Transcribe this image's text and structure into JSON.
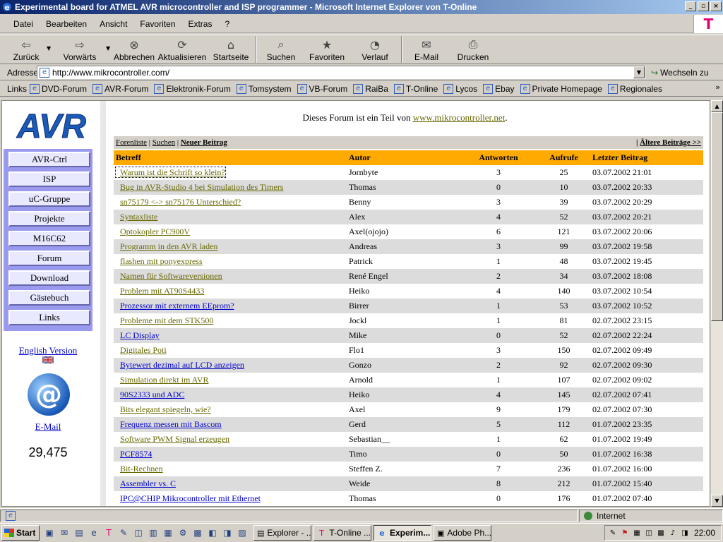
{
  "window": {
    "title": "Experimental board for ATMEL AVR microcontroller and ISP programmer - Microsoft Internet Explorer von T-Online",
    "btn_min": "_",
    "btn_max": "▫",
    "btn_close": "×"
  },
  "menu": [
    "Datei",
    "Bearbeiten",
    "Ansicht",
    "Favoriten",
    "Extras",
    "?"
  ],
  "isp_logo": "T",
  "toolbar": {
    "back": "Zurück",
    "forward": "Vorwärts",
    "stop": "Abbrechen",
    "refresh": "Aktualisieren",
    "home": "Startseite",
    "search": "Suchen",
    "favorites": "Favoriten",
    "history": "Verlauf",
    "mail": "E-Mail",
    "print": "Drucken"
  },
  "address": {
    "label": "Adresse",
    "url": "http://www.mikrocontroller.com/",
    "go": "Wechseln zu"
  },
  "links": {
    "label": "Links",
    "items": [
      "DVD-Forum",
      "AVR-Forum",
      "Elektronik-Forum",
      "Tomsystem",
      "VB-Forum",
      "RaiBa",
      "T-Online",
      "Lycos",
      "Ebay",
      "Private Homepage",
      "Regionales"
    ]
  },
  "sidebar": {
    "logo_text": "AVR",
    "nav": [
      "AVR-Ctrl",
      "ISP",
      "uC-Gruppe",
      "Projekte",
      "M16C62",
      "Forum",
      "Download",
      "Gästebuch",
      "Links"
    ],
    "english": "English Version",
    "email": "E-Mail",
    "counter": "29,475"
  },
  "forum": {
    "notice_prefix": "Dieses Forum ist ein Teil von ",
    "notice_link": "www.mikrocontroller.net",
    "notice_suffix": ".",
    "nav_list": "Forenliste",
    "nav_search": "Suchen",
    "nav_new": "Neuer Beitrag",
    "sep": "|",
    "nav_older": "Ältere Beiträge >>",
    "headers": {
      "subject": "Betreff",
      "author": "Autor",
      "replies": "Antworten",
      "views": "Aufrufe",
      "last": "Letzter Beitrag"
    },
    "rows": [
      {
        "subject": "Warum ist die Schrift so klein?",
        "author": "Jornbyte",
        "replies": "3",
        "views": "25",
        "last": "03.07.2002 21:01",
        "state": "focused"
      },
      {
        "subject": "Bug in AVR-Studio 4 bei Simulation des Timers",
        "author": "Thomas",
        "replies": "0",
        "views": "10",
        "last": "03.07.2002 20:33",
        "state": "visited"
      },
      {
        "subject": "sn75179 <-> sn75176 Unterschied?",
        "author": "Benny",
        "replies": "3",
        "views": "39",
        "last": "03.07.2002 20:29",
        "state": "visited"
      },
      {
        "subject": "Syntaxliste",
        "author": "Alex",
        "replies": "4",
        "views": "52",
        "last": "03.07.2002 20:21",
        "state": "visited"
      },
      {
        "subject": "Optokopler PC900V",
        "author": "Axel(ojojo)",
        "replies": "6",
        "views": "121",
        "last": "03.07.2002 20:06",
        "state": "visited"
      },
      {
        "subject": "Programm in den AVR laden",
        "author": "Andreas",
        "replies": "3",
        "views": "99",
        "last": "03.07.2002 19:58",
        "state": "visited"
      },
      {
        "subject": "flashen mit ponyexpress",
        "author": "Patrick",
        "replies": "1",
        "views": "48",
        "last": "03.07.2002 19:45",
        "state": "visited"
      },
      {
        "subject": "Namen für Softwareversionen",
        "author": "René Engel",
        "replies": "2",
        "views": "34",
        "last": "03.07.2002 18:08",
        "state": "visited"
      },
      {
        "subject": "Problem mit AT90S4433",
        "author": "Heiko",
        "replies": "4",
        "views": "140",
        "last": "03.07.2002 10:54",
        "state": "visited"
      },
      {
        "subject": "Prozessor mit externem EEprom?",
        "author": "Birrer",
        "replies": "1",
        "views": "53",
        "last": "03.07.2002 10:52",
        "state": "fresh"
      },
      {
        "subject": "Probleme mit dem STK500",
        "author": "Jockl",
        "replies": "1",
        "views": "81",
        "last": "02.07.2002 23:15",
        "state": "visited"
      },
      {
        "subject": "LC Display",
        "author": "Mike",
        "replies": "0",
        "views": "52",
        "last": "02.07.2002 22:24",
        "state": "fresh"
      },
      {
        "subject": "Digitales Poti",
        "author": "Flo1",
        "replies": "3",
        "views": "150",
        "last": "02.07.2002 09:49",
        "state": "visited"
      },
      {
        "subject": "Bytewert dezimal auf LCD anzeigen",
        "author": "Gonzo",
        "replies": "2",
        "views": "92",
        "last": "02.07.2002 09:30",
        "state": "fresh"
      },
      {
        "subject": "Simulation direkt im AVR",
        "author": "Arnold",
        "replies": "1",
        "views": "107",
        "last": "02.07.2002 09:02",
        "state": "visited"
      },
      {
        "subject": "90S2333 und ADC",
        "author": "Heiko",
        "replies": "4",
        "views": "145",
        "last": "02.07.2002 07:41",
        "state": "fresh"
      },
      {
        "subject": "Bits elegant spiegeln, wie?",
        "author": "Axel",
        "replies": "9",
        "views": "179",
        "last": "02.07.2002 07:30",
        "state": "visited"
      },
      {
        "subject": "Frequenz messen mit Bascom",
        "author": "Gerd",
        "replies": "5",
        "views": "112",
        "last": "01.07.2002 23:35",
        "state": "fresh"
      },
      {
        "subject": "Software PWM Signal erzeugen",
        "author": "Sebastian__",
        "replies": "1",
        "views": "62",
        "last": "01.07.2002 19:49",
        "state": "visited"
      },
      {
        "subject": "PCF8574",
        "author": "Timo",
        "replies": "0",
        "views": "50",
        "last": "01.07.2002 16:38",
        "state": "fresh"
      },
      {
        "subject": "Bit-Rechnen",
        "author": "Steffen Z.",
        "replies": "7",
        "views": "236",
        "last": "01.07.2002 16:00",
        "state": "visited"
      },
      {
        "subject": "Assembler vs. C",
        "author": "Weide",
        "replies": "8",
        "views": "212",
        "last": "01.07.2002 15:40",
        "state": "fresh"
      },
      {
        "subject": "IPC@CHIP Mikrocontroller mit Ethernet",
        "author": "Thomas",
        "replies": "0",
        "views": "176",
        "last": "01.07.2002 07:40",
        "state": "fresh"
      }
    ]
  },
  "status": {
    "text": "",
    "zone": "Internet"
  },
  "taskbar": {
    "start": "Start",
    "tasks": [
      {
        "label": "Explorer - ...",
        "active": false
      },
      {
        "label": "T-Online ...",
        "active": false
      },
      {
        "label": "Experim...",
        "active": true
      },
      {
        "label": "Adobe Ph...",
        "active": false
      }
    ],
    "clock": "22:00"
  },
  "icons": {
    "page": "ie-page-icon",
    "globe": "internet-zone-icon"
  }
}
